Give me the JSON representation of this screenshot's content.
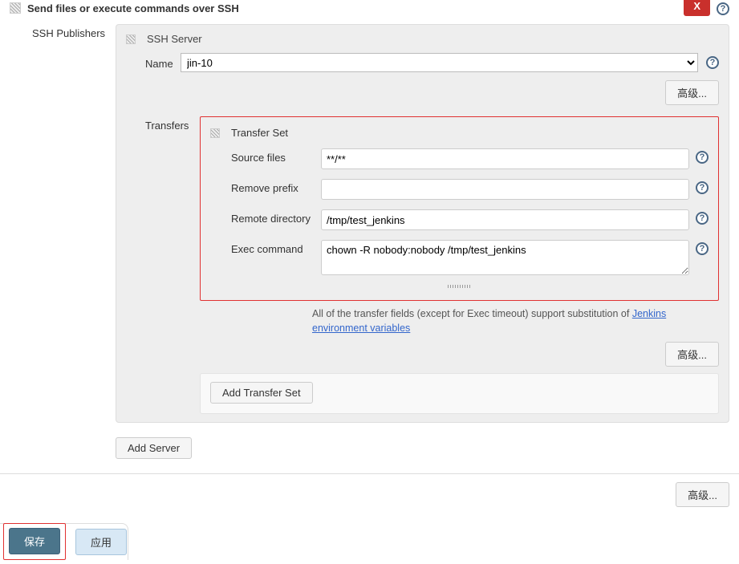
{
  "header": {
    "title": "Send files or execute commands over SSH",
    "close_label": "X"
  },
  "labels": {
    "ssh_publishers": "SSH Publishers",
    "ssh_server": "SSH Server",
    "name": "Name",
    "advanced": "高级...",
    "transfers": "Transfers",
    "transfer_set": "Transfer Set",
    "source_files": "Source files",
    "remove_prefix": "Remove prefix",
    "remote_directory": "Remote directory",
    "exec_command": "Exec command",
    "add_transfer_set": "Add Transfer Set",
    "add_server": "Add Server",
    "note_prefix": "All of the transfer fields (except for Exec timeout) support substitution of ",
    "note_link": "Jenkins environment variables"
  },
  "values": {
    "server_name_options": [
      "jin-10"
    ],
    "server_name_selected": "jin-10",
    "source_files": "**/**",
    "remove_prefix": "",
    "remote_directory": "/tmp/test_jenkins",
    "exec_command": "chown -R nobody:nobody /tmp/test_jenkins"
  },
  "footer": {
    "save": "保存",
    "apply": "应用",
    "advanced": "高级..."
  }
}
